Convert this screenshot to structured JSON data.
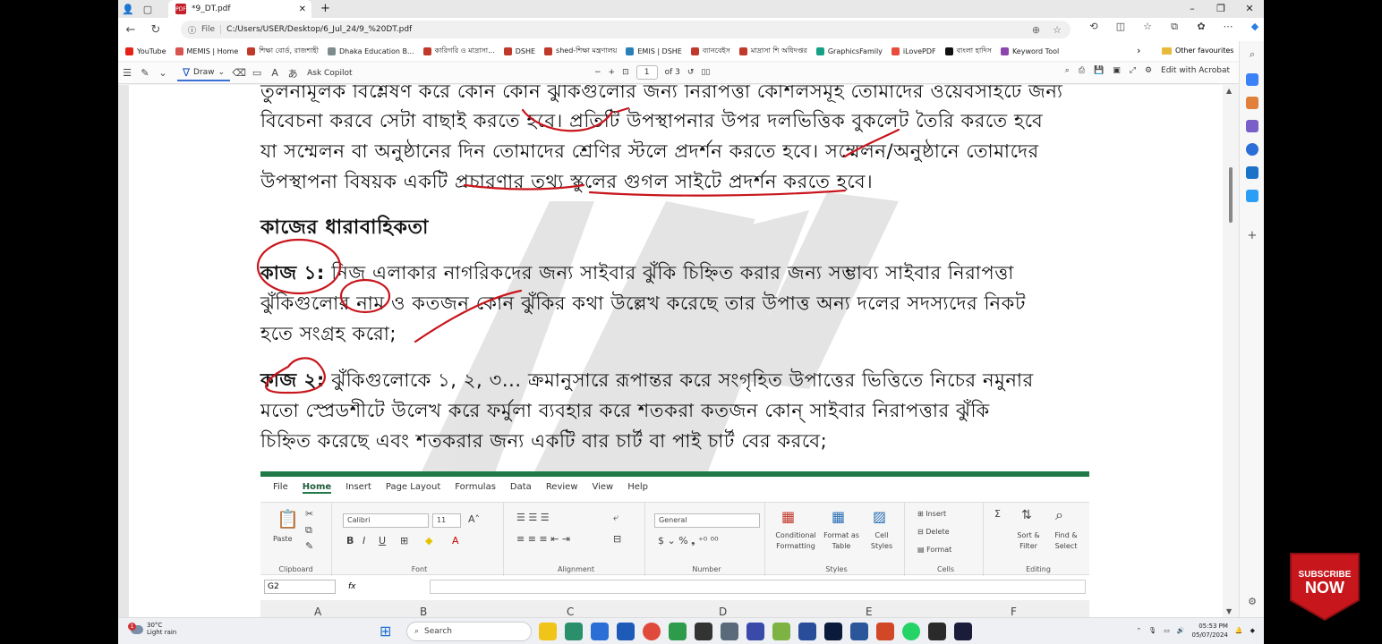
{
  "browser": {
    "tab_title": "*9_DT.pdf",
    "url_prefix": "File",
    "url": "C:/Users/USER/Desktop/6_Jul_24/9_%20DT.pdf",
    "bookmarks": [
      {
        "label": "YouTube",
        "color": "#e62117"
      },
      {
        "label": "MEMIS | Home",
        "color": "#d9534f"
      },
      {
        "label": "শিক্ষা বোর্ড, রাজশাহী",
        "color": "#c0392b"
      },
      {
        "label": "Dhaka Education B...",
        "color": "#7f8c8d"
      },
      {
        "label": "কারিগরি ও মাদ্রাসা...",
        "color": "#c0392b"
      },
      {
        "label": "DSHE",
        "color": "#c0392b"
      },
      {
        "label": "shed-শিক্ষা মন্ত্রণালয়",
        "color": "#c0392b"
      },
      {
        "label": "EMIS | DSHE",
        "color": "#2980b9"
      },
      {
        "label": "ব্যানবেইস",
        "color": "#c0392b"
      },
      {
        "label": "মাদ্রাসা শি অধিদপ্তর",
        "color": "#c0392b"
      },
      {
        "label": "GraphicsFamily",
        "color": "#16a085"
      },
      {
        "label": "iLovePDF",
        "color": "#e74c3c"
      },
      {
        "label": "বাংলা হাদিস",
        "color": "#111111"
      },
      {
        "label": "Keyword Tool",
        "color": "#8e44ad"
      }
    ],
    "other_favourites": "Other favourites"
  },
  "pdf_toolbar": {
    "draw_label": "Draw",
    "ask_copilot": "Ask Copilot",
    "page_current": "1",
    "page_total": "of 3",
    "edit_acrobat": "Edit with Acrobat"
  },
  "document": {
    "lines_top": [
      "তুলনামূলক বিশ্লেষণ করে কোন কোন ঝুঁকিগুলোর জন্য নিরাপত্তা কৌশলসমূহ তোমাদের ওয়েবসাইটে জন্য",
      "বিবেচনা করবে সেটা বাছাই করতে হবে। প্রতিটি উপস্থাপনার উপর দলভিত্তিক বুকলেট তৈরি করতে হবে",
      "যা সম্মেলন বা অনুষ্ঠানের দিন তোমাদের শ্রেণির স্টলে প্রদর্শন করতে হবে। সম্মেলন/অনুষ্ঠানে তোমাদের",
      "উপস্থাপনা বিষয়ক একটি প্রচারণার তথ্য স্কুলের গুগল সাইটে প্রদর্শন করতে হবে।"
    ],
    "heading": "কাজের ধারাবাহিকতা",
    "task1_label": "কাজ ১:",
    "task1_lines": [
      "নিজ এলাকার নাগরিকদের জন্য সাইবার ঝুঁকি চিহ্নিত করার জন্য সম্ভাব্য সাইবার নিরাপত্তা",
      "ঝুঁকিগুলোর নাম ও কতজন কোন ঝুঁকির কথা উল্লেখ করেছে তার উপাত্ত অন্য দলের সদস্যদের নিকট",
      "হতে সংগ্রহ করো;"
    ],
    "task2_label": "কাজ ২:",
    "task2_lines": [
      "ঝুঁকিগুলোকে ১, ২, ৩... ক্রমানুসারে রূপান্তর করে সংগৃহিত উপাত্তের ভিত্তিতে নিচের নমুনার",
      "মতো স্প্রেডশীটে উলেখ করে ফর্মুলা ব্যবহার করে শতকরা কতজন কোন্ সাইবার নিরাপত্তার ঝুঁকি",
      "চিহ্নিত করেছে এবং শতকরার জন্য একটি বার চার্ট বা পাই চার্ট বের করবে;"
    ]
  },
  "excel": {
    "menu": [
      "File",
      "Home",
      "Insert",
      "Page Layout",
      "Formulas",
      "Data",
      "Review",
      "View",
      "Help"
    ],
    "active_menu": "Home",
    "paste": "Paste",
    "clipboard": "Clipboard",
    "font_name": "Calibri",
    "font_size": "11",
    "font_group": "Font",
    "alignment_group": "Alignment",
    "number_format": "General",
    "number_group": "Number",
    "conditional": "Conditional",
    "formatting": "Formatting",
    "format_as": "Format as",
    "table": "Table",
    "cell": "Cell",
    "styles_btn": "Styles",
    "styles_group": "Styles",
    "insert_btn": "Insert",
    "delete_btn": "Delete",
    "format_btn": "Format",
    "cells_group": "Cells",
    "sort_filter": "Sort &",
    "filter": "Filter",
    "find_select": "Find &",
    "select": "Select",
    "editing_group": "Editing",
    "name_box": "G2",
    "fx": "fx",
    "columns": [
      "A",
      "B",
      "C",
      "D",
      "E",
      "F"
    ]
  },
  "taskbar": {
    "temp": "30°C",
    "weather": "Light rain",
    "notif_count": "1",
    "search": "Search",
    "time": "05:53 PM",
    "date": "05/07/2024"
  },
  "overlay": {
    "subscribe": "SUBSCRIBE",
    "now": "NOW"
  },
  "colors": {
    "ink": "#c8161d",
    "excel_green": "#1f7a47",
    "watermark": "#d9d9d9"
  }
}
